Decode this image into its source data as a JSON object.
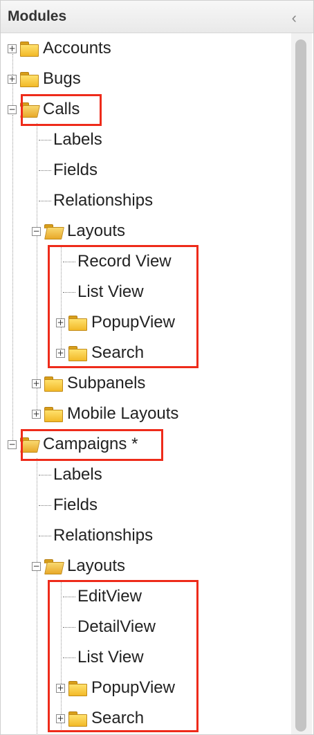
{
  "header": {
    "title": "Modules",
    "collapse_icon": "chevron-left-icon"
  },
  "tree": {
    "accounts": "Accounts",
    "bugs": "Bugs",
    "calls": {
      "label": "Calls",
      "labels": "Labels",
      "fields": "Fields",
      "relationships": "Relationships",
      "layouts": "Layouts",
      "record_view": "Record View",
      "list_view": "List View",
      "popup_view": "PopupView",
      "search": "Search",
      "subpanels": "Subpanels",
      "mobile_layouts": "Mobile Layouts"
    },
    "campaigns": {
      "label": "Campaigns *",
      "labels": "Labels",
      "fields": "Fields",
      "relationships": "Relationships",
      "layouts": "Layouts",
      "edit_view": "EditView",
      "detail_view": "DetailView",
      "list_view": "List View",
      "popup_view": "PopupView",
      "search": "Search"
    }
  },
  "colors": {
    "highlight": "#ee2b1a",
    "folder": "#f2b928"
  }
}
